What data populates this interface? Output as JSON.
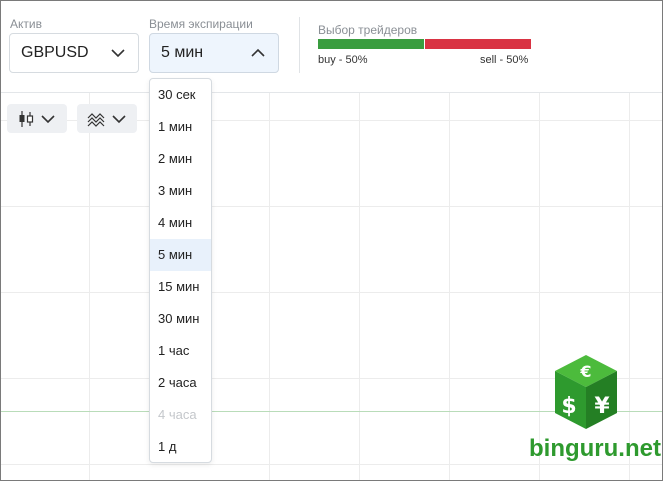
{
  "asset": {
    "label": "Актив",
    "value": "GBPUSD"
  },
  "expiry": {
    "label": "Время экспирации",
    "value": "5 мин",
    "options": [
      {
        "text": "30 сек",
        "state": "normal"
      },
      {
        "text": "1 мин",
        "state": "normal"
      },
      {
        "text": "2 мин",
        "state": "normal"
      },
      {
        "text": "3 мин",
        "state": "normal"
      },
      {
        "text": "4 мин",
        "state": "normal"
      },
      {
        "text": "5 мин",
        "state": "selected"
      },
      {
        "text": "15 мин",
        "state": "normal"
      },
      {
        "text": "30 мин",
        "state": "normal"
      },
      {
        "text": "1 час",
        "state": "normal"
      },
      {
        "text": "2 часа",
        "state": "normal"
      },
      {
        "text": "4 часа",
        "state": "disabled"
      },
      {
        "text": "1 д",
        "state": "normal"
      }
    ]
  },
  "traders": {
    "label": "Выбор трейдеров",
    "buy_label": "buy - 50%",
    "sell_label": "sell - 50%",
    "buy_fraction": 0.5,
    "sell_fraction": 0.5,
    "buy_color": "#3a9d3f",
    "sell_color": "#d93343"
  },
  "toolbar": {
    "chart_type_icon": "candlestick-icon",
    "indicators_icon": "indicators-icon"
  },
  "watermark": {
    "text": "binguru.net",
    "color": "#2e9a2e"
  }
}
